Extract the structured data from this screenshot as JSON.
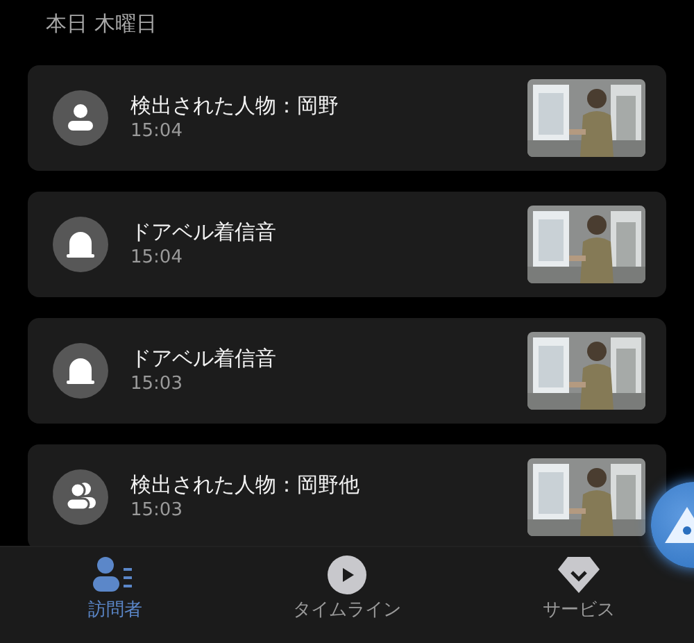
{
  "heading": "本日 木曜日",
  "events": [
    {
      "kind": "person",
      "title": "検出された人物：岡野",
      "time": "15:04"
    },
    {
      "kind": "bell",
      "title": "ドアベル着信音",
      "time": "15:04"
    },
    {
      "kind": "bell",
      "title": "ドアベル着信音",
      "time": "15:03"
    },
    {
      "kind": "people",
      "title": "検出された人物：岡野他",
      "time": "15:03"
    }
  ],
  "nav": [
    {
      "kind": "visitors",
      "label": "訪問者",
      "selected": true
    },
    {
      "kind": "timeline",
      "label": "タイムライン",
      "selected": false
    },
    {
      "kind": "services",
      "label": "サービス",
      "selected": false
    }
  ]
}
